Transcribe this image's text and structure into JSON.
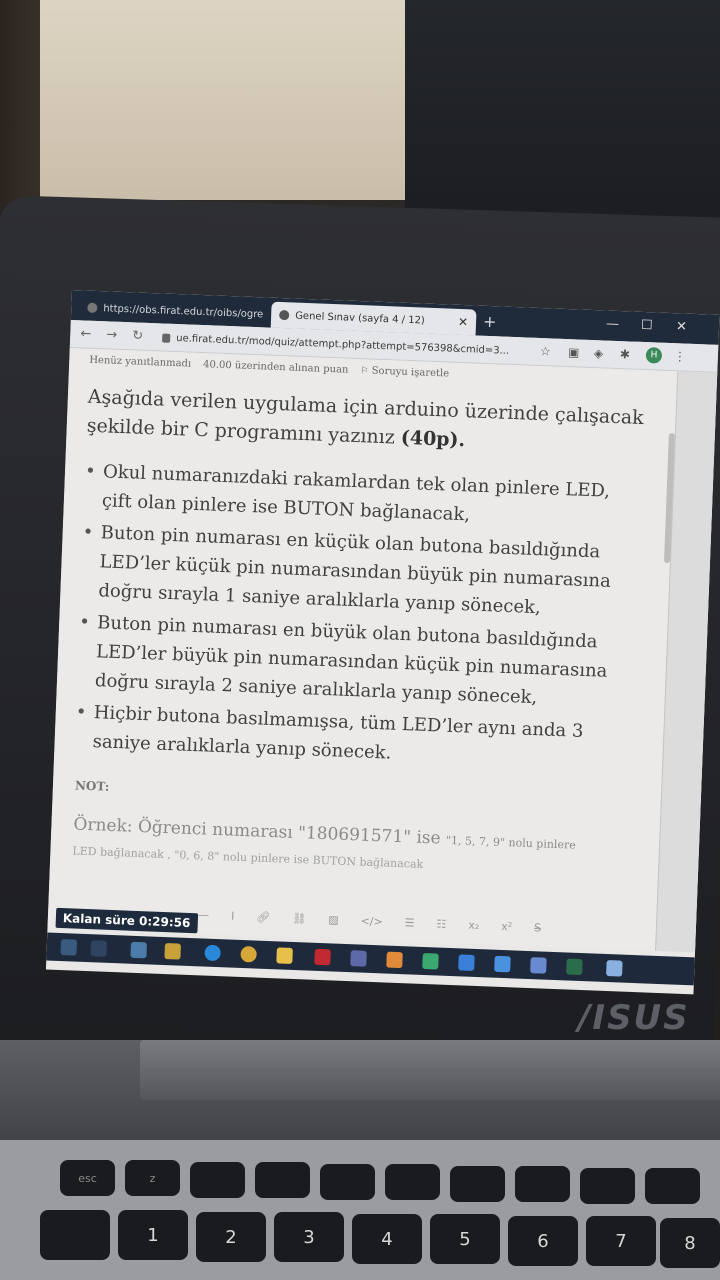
{
  "browser": {
    "tabs": [
      {
        "label": "https://obs.firat.edu.tr/oibs/ogre",
        "active": false
      },
      {
        "label": "Genel Sınav (sayfa 4 / 12)",
        "active": true
      }
    ],
    "new_tab": "+",
    "address": "ue.firat.edu.tr/mod/quiz/attempt.php?attempt=576398&cmid=3...",
    "profile_initial": "H"
  },
  "quiz": {
    "status": "Henüz yanıtlanmadı",
    "points": "40.00 üzerinden alınan puan",
    "flag_label": "Soruyu işaretle",
    "question_line1": "Aşağıda verilen uygulama için arduino üzerinde çalışacak",
    "question_line2": "şekilde bir C programını yazınız",
    "question_points": "(40p).",
    "bullets": [
      "Okul numaranızdaki rakamlardan tek olan pinlere LED, çift olan pinlere ise BUTON bağlanacak,",
      "Buton pin numarası en küçük olan butona basıldığında LED’ler küçük pin numarasından büyük pin numarasına doğru sırayla 1 saniye aralıklarla yanıp sönecek,",
      "Buton pin numarası en büyük olan butona basıldığında LED’ler büyük pin numarasından küçük pin numarasına doğru sırayla 2 saniye aralıklarla yanıp sönecek,",
      "Hiçbir butona basılmamışsa, tüm LED’ler aynı anda 3 saniye aralıklarla yanıp sönecek."
    ],
    "note_title": "NOT:",
    "example_main": "Örnek: Öğrenci numarası \"180691571\" ise",
    "example_small": "\"1, 5, 7, 9\" nolu pinlere",
    "example_line2": "LED  bağlanacak , \"0, 6, 8\" nolu pinlere ise BUTON bağlanacak"
  },
  "timer": "Kalan süre 0:29:56",
  "laptop_brand": "/ISUS",
  "keyboard": {
    "fkeys": [
      "esc",
      "z",
      "",
      "",
      "",
      "",
      "",
      "",
      "",
      "",
      ""
    ],
    "numbers": [
      "",
      "1",
      "2",
      "3",
      "4",
      "5",
      "6",
      "7",
      "8"
    ]
  }
}
